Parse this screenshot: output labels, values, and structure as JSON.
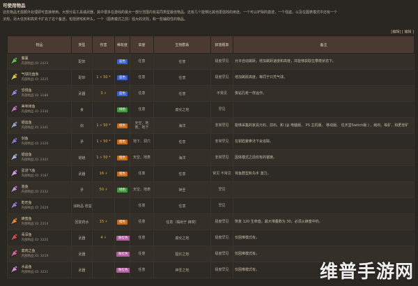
{
  "page": {
    "title": "可使用物品",
    "intro": [
      "这些物品无需额外处理即可直接使用。大部分是工具或武器，其中很多在游戏的最大一部分范围内有是同类型最佳物品。还有几个能够比其他更强效的用途，一个可以铲除的激波，一个强盗，以及在图表模式中还有一个",
      "法规。另大任务和高奖卡扩充了这个备选，包括骑宅和斧头，一个（图表模式之前）强大的法则，和一些辅助性的物品。"
    ],
    "editbar": "[编辑] [ 编辑 ]"
  },
  "columns": [
    "",
    "物品",
    "类型",
    "伤害",
    "稀有度",
    "高度",
    "生物群系",
    "掉落概率",
    "备注"
  ],
  "rows": [
    {
      "icon": "green-vine-icon",
      "color": "#5fbf4a",
      "name": "藤蔓",
      "id": "内部物品 ID: 2423",
      "type": "配饰",
      "damage": "",
      "rarity": "蓝色",
      "rarity_color": "#3a5fd0",
      "height": "任意",
      "biome": "任意",
      "drop": "极度罕见",
      "note": "允许自动跳跃，增加跳跃速度和高度，并能够获取在攀爬状态下。"
    },
    {
      "icon": "yellow-bulb-icon",
      "color": "#d9c24a",
      "name": "气球托盘条",
      "id": "内部物品 ID: 3225",
      "type": "配饰",
      "damage": "1 ⚡ 50 *",
      "rarity": "蓝色",
      "rarity_color": "#3a5fd0",
      "height": "任意",
      "biome": "任意",
      "drop": "极度罕见",
      "note": "增加跳跃高度，等同于只凭气球。"
    },
    {
      "icon": "dark-blade-icon",
      "color": "#8a8ad8",
      "name": "恐惧鱼",
      "id": "内部物品 ID: 3186",
      "type": "武器",
      "damage": "3 ⚡",
      "rarity": "蓝色",
      "rarity_color": "#3a5fd0",
      "height": "任意",
      "biome": "任意",
      "drop": "不常见",
      "note": "像钻孔枪一样运作。"
    },
    {
      "icon": "pink-star-icon",
      "color": "#c074c0",
      "name": "美味烤鱼",
      "id": "内部物品 ID: 2330",
      "type": "食",
      "damage": "",
      "rarity": "绿色",
      "rarity_color": "#3f9a3a",
      "height": "任意",
      "biome": "腐化之地",
      "drop": "罕见",
      "note": ""
    },
    {
      "icon": "bone-sword-icon",
      "color": "#9aa5c8",
      "name": "锯齿鱼",
      "id": "内部物品 ID: 2341",
      "type": "剑",
      "damage": "1 ⚡ 50 *",
      "rarity": "橙色",
      "rarity_color": "#c76a1a",
      "height": "天空、地表、地下",
      "biome": "海洋",
      "drop": "非常罕见",
      "note": "能够采集的家具元石、前石、和 (@ 电脑版、 PS 主机版、 移动版、 任天堂Switch版 ) 、鱿石、铂矿、和肥皂矿"
    },
    {
      "icon": "dark-sword-icon",
      "color": "#7c7cc8",
      "name": "剑鱼",
      "id": "内部物品 ID: 2320",
      "type": "矛",
      "damage": "1 ⚡ 50 *",
      "rarity": "橙色",
      "rarity_color": "#c76a1a",
      "height": "地下、洞穴",
      "biome": "任意",
      "drop": "非常罕见",
      "note": "在钥匙聚拳法下会追踪。"
    },
    {
      "icon": "gun-fish-icon",
      "color": "#a9b8d8",
      "name": "锯齿鱼",
      "id": "内部物品 ID: 2342",
      "type": "锯链",
      "damage": "1 ⚡ 50 *",
      "rarity": "橙色",
      "rarity_color": "#c76a1a",
      "height": "天空、地表",
      "biome": "海洋",
      "drop": "非常罕见",
      "note": "因体模式之前仅有的锯链。"
    },
    {
      "icon": "staff-fish-icon",
      "color": "#d0a0e0",
      "name": "星迹飞鱼",
      "id": "内部物品 ID: 3187",
      "type": "武器",
      "damage": "16 ⚡",
      "rarity": "橙色",
      "rarity_color": "#c76a1a",
      "height": "任意",
      "biome": "任意",
      "drop": "常见 不常见",
      "note": "将鱼群型和鸟手 激力。"
    },
    {
      "icon": "pink-fish-icon",
      "color": "#c090d0",
      "name": "渔鱼",
      "id": "内部物品 ID: 2332",
      "type": "矛",
      "damage": "50 ⚡",
      "rarity": "绿色",
      "rarity_color": "#3f9a3a",
      "height": "天空、地表",
      "biome": "神圣",
      "drop": "罕见",
      "note": ""
    },
    {
      "icon": "purple-fish-icon",
      "color": "#9a7ad0",
      "name": "乾旺鱼",
      "id": "内部物品 ID: 2429",
      "type": "消耗品 增益",
      "damage": "",
      "rarity": "",
      "rarity_color": "",
      "height": "任意",
      "biome": "任意",
      "drop": "罕见",
      "note": ""
    },
    {
      "icon": "orange-fish-icon",
      "color": "#e08a3a",
      "name": "蜂蜜鱼",
      "id": "内部物品 ID: 2314",
      "type": "回复药水",
      "damage": "15 ⚡",
      "rarity": "橙色",
      "rarity_color": "#c76a1a",
      "height": "任意",
      "biome": "任意（橘树于 蜂窝）",
      "drop": "极度罕见",
      "note": "恢复 120 生命值，最大堆叠数为 30，必须从蜂蜜中钓。"
    },
    {
      "icon": "red-blade-icon",
      "color": "#d05050",
      "name": "毒深鱼",
      "id": "内部物品 ID: 3220",
      "type": "武器",
      "damage": "4 ⚡",
      "rarity": "粉红色",
      "rarity_color": "#b25aa0",
      "height": "任意",
      "biome": "腐化之地",
      "drop": "极度罕见",
      "note": "仅困难模式有。"
    },
    {
      "icon": "crimson-blade-icon",
      "color": "#d06a9a",
      "name": "腐肉之鱼",
      "id": "内部物品 ID: 3219",
      "type": "武器",
      "damage": "",
      "rarity": "粉红色",
      "rarity_color": "#b25aa0",
      "height": "任意",
      "biome": "猩红之地",
      "drop": "极度罕见",
      "note": "仅困难模式有。"
    },
    {
      "icon": "crystal-blade-icon",
      "color": "#d08ae0",
      "name": "水晶鱼",
      "id": "内部物品 ID: 3221",
      "type": "武器",
      "damage": "",
      "rarity": "粉红色",
      "rarity_color": "#b25aa0",
      "height": "任意",
      "biome": "神圣之地",
      "drop": "极度罕见",
      "note": "仅困难模式有。"
    }
  ],
  "watermark": "维普手游网"
}
